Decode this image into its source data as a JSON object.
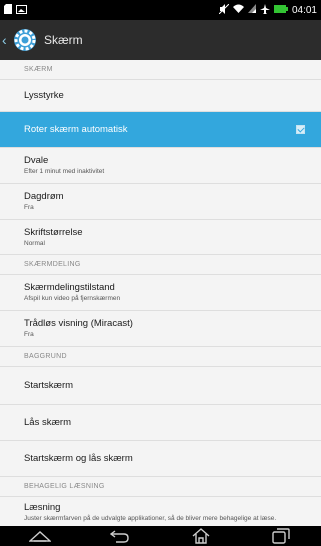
{
  "status_bar": {
    "time": "04:01",
    "icons": [
      "sd-card-icon",
      "image-notification-icon",
      "mute-icon",
      "wifi-icon",
      "signal-icon",
      "airplane-icon",
      "battery-icon"
    ]
  },
  "action_bar": {
    "title": "Skærm",
    "icon": "settings-gear-icon"
  },
  "sections": [
    {
      "type": "header",
      "label": "SKÆRM"
    },
    {
      "type": "item",
      "title": "Lysstyrke",
      "subtitle": ""
    },
    {
      "type": "item",
      "title": "Roter skærm automatisk",
      "subtitle": "",
      "selected": true,
      "checkbox": true,
      "checked": true
    },
    {
      "type": "item",
      "title": "Dvale",
      "subtitle": "Efter 1 minut med inaktivitet"
    },
    {
      "type": "item",
      "title": "Dagdrøm",
      "subtitle": "Fra"
    },
    {
      "type": "item",
      "title": "Skriftstørrelse",
      "subtitle": "Normal"
    },
    {
      "type": "header",
      "label": "SKÆRMDELING"
    },
    {
      "type": "item",
      "title": "Skærmdelingstilstand",
      "subtitle": "Afspil kun video på fjernskærmen"
    },
    {
      "type": "item",
      "title": "Trådløs visning (Miracast)",
      "subtitle": "Fra"
    },
    {
      "type": "header",
      "label": "BAGGRUND"
    },
    {
      "type": "item",
      "title": "Startskærm",
      "subtitle": ""
    },
    {
      "type": "item",
      "title": "Lås skærm",
      "subtitle": ""
    },
    {
      "type": "item",
      "title": "Startskærm og lås skærm",
      "subtitle": ""
    },
    {
      "type": "header",
      "label": "BEHAGELIG LÆSNING"
    },
    {
      "type": "item",
      "title": "Læsning",
      "subtitle": "Juster skærmfarven på de udvalgte applikationer, så de bliver mere behagelige at læse."
    }
  ],
  "nav_bar": {
    "buttons": [
      "up-icon",
      "back-icon",
      "home-icon",
      "recent-apps-icon"
    ]
  },
  "colors": {
    "accent": "#33a7dd",
    "action_bar_bg": "#2c2c2c",
    "list_bg": "#f4f4f4"
  }
}
